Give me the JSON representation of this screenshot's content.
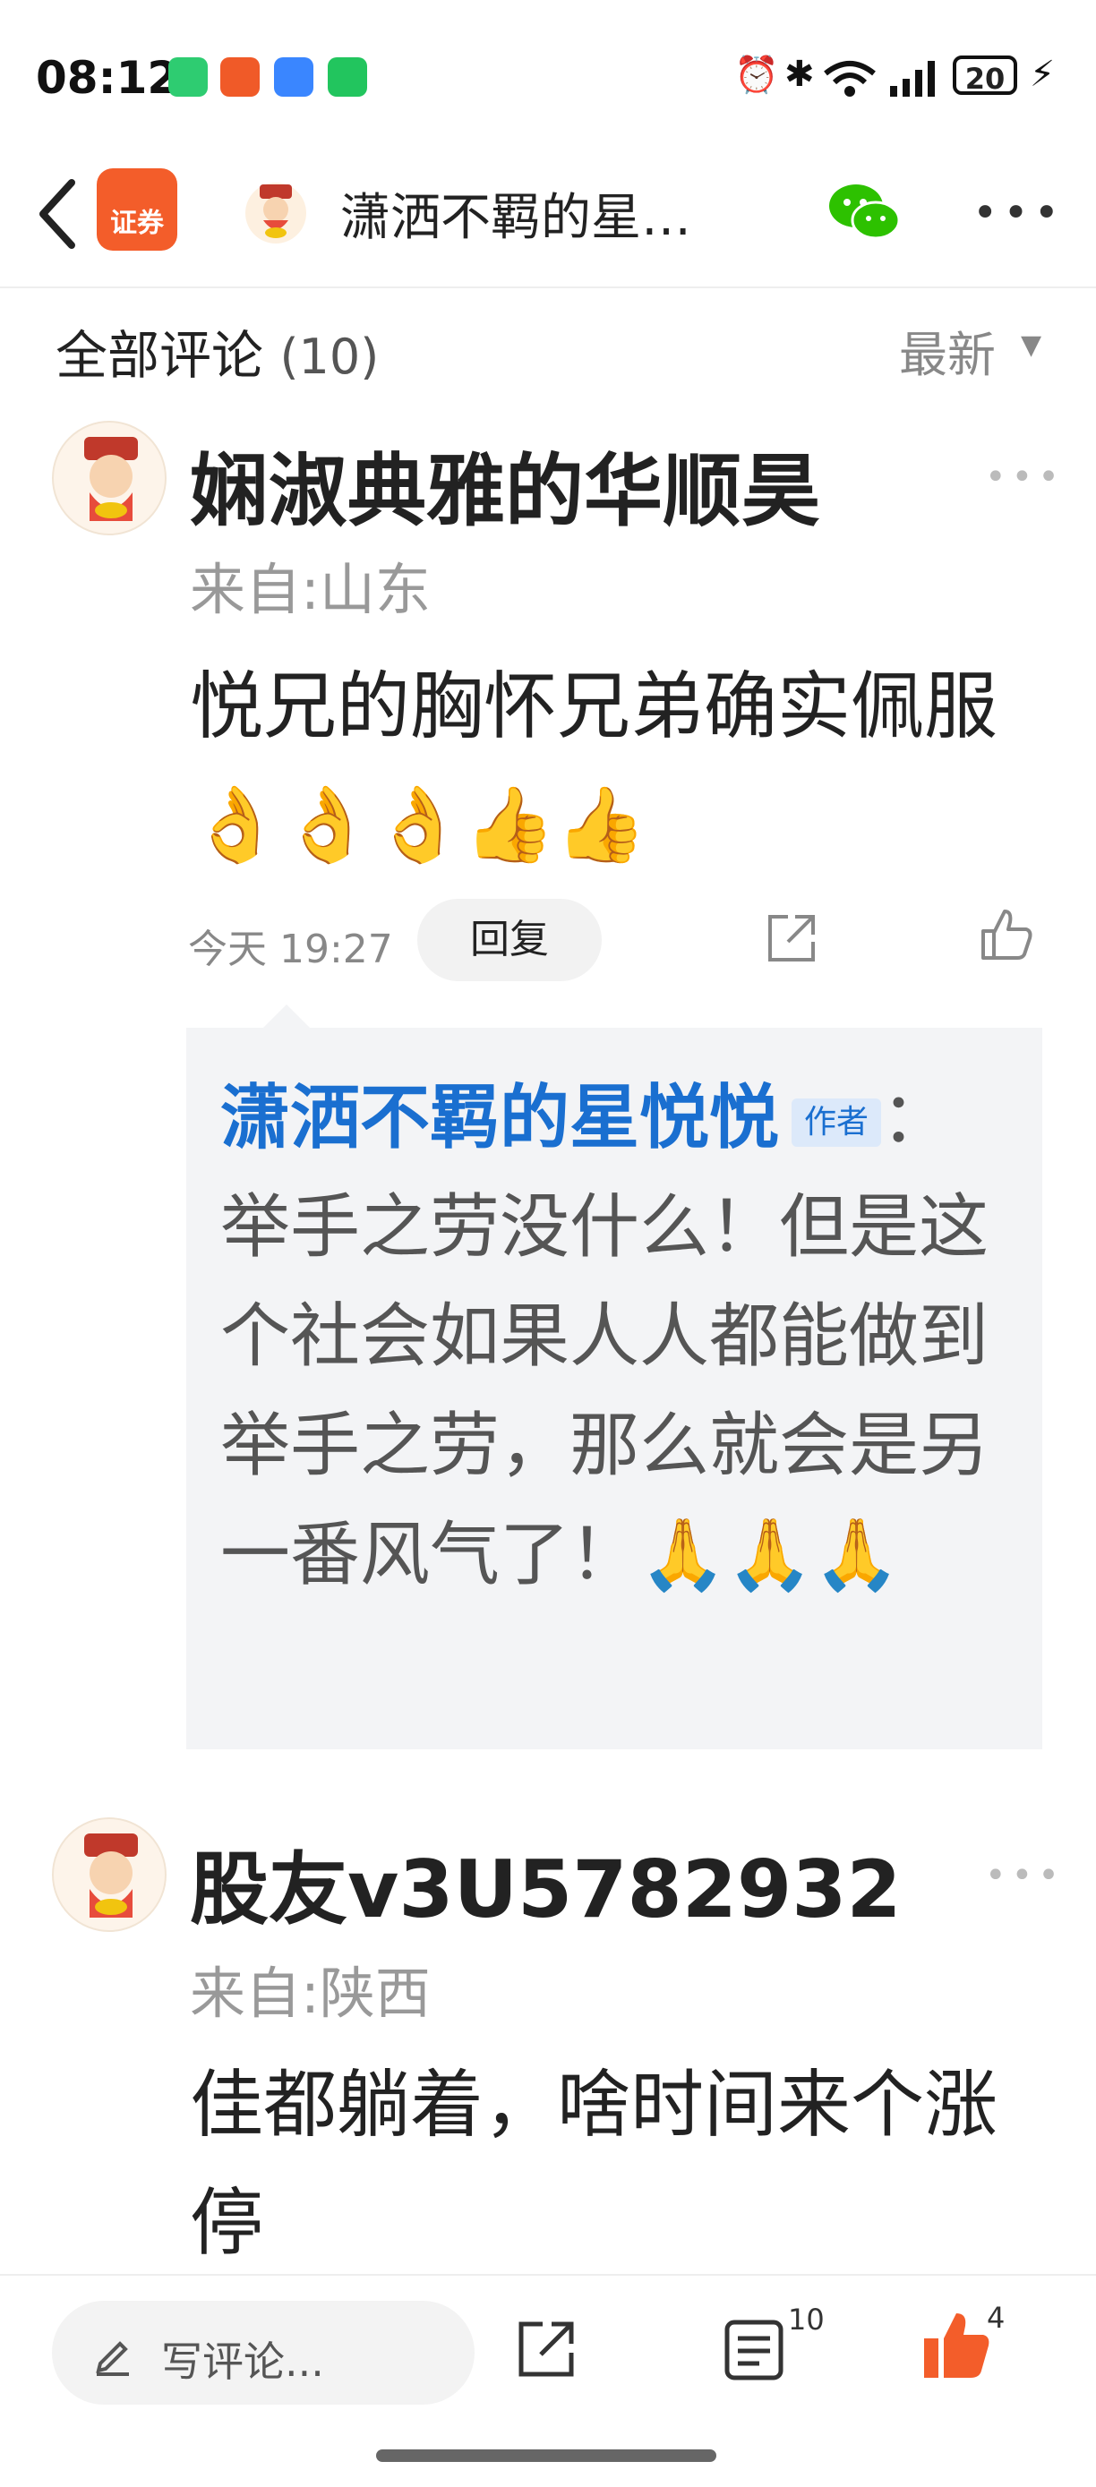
{
  "status_bar": {
    "time": "08:12",
    "battery": "20"
  },
  "nav": {
    "title": "潇洒不羁的星…",
    "logo_label": "证券"
  },
  "section": {
    "title": "全部评论",
    "count": "(10)",
    "sort_label": "最新"
  },
  "comments": [
    {
      "username": "娴淑典雅的华顺昊",
      "location": "来自:山东",
      "text": "悦兄的胸怀兄弟确实佩服👌👌👌👍👍",
      "timestamp": "今天 19:27",
      "reply_label": "回复",
      "reply": {
        "author": "潇洒不羁的星悦悦",
        "badge": "作者",
        "text": "举手之劳没什么！但是这个社会如果人人都能做到举手之劳，那么就会是另一番风气了！🙏🙏🙏"
      }
    },
    {
      "username": "股友v3U5782932",
      "location": "来自:陕西",
      "text": "佳都躺着，啥时间来个涨停"
    }
  ],
  "bottom_bar": {
    "write_placeholder": "写评论...",
    "comment_count": "10",
    "like_count": "4"
  },
  "colors": {
    "accent": "#f35d2a",
    "link": "#1a6fd0",
    "wechat": "#2dc100"
  }
}
